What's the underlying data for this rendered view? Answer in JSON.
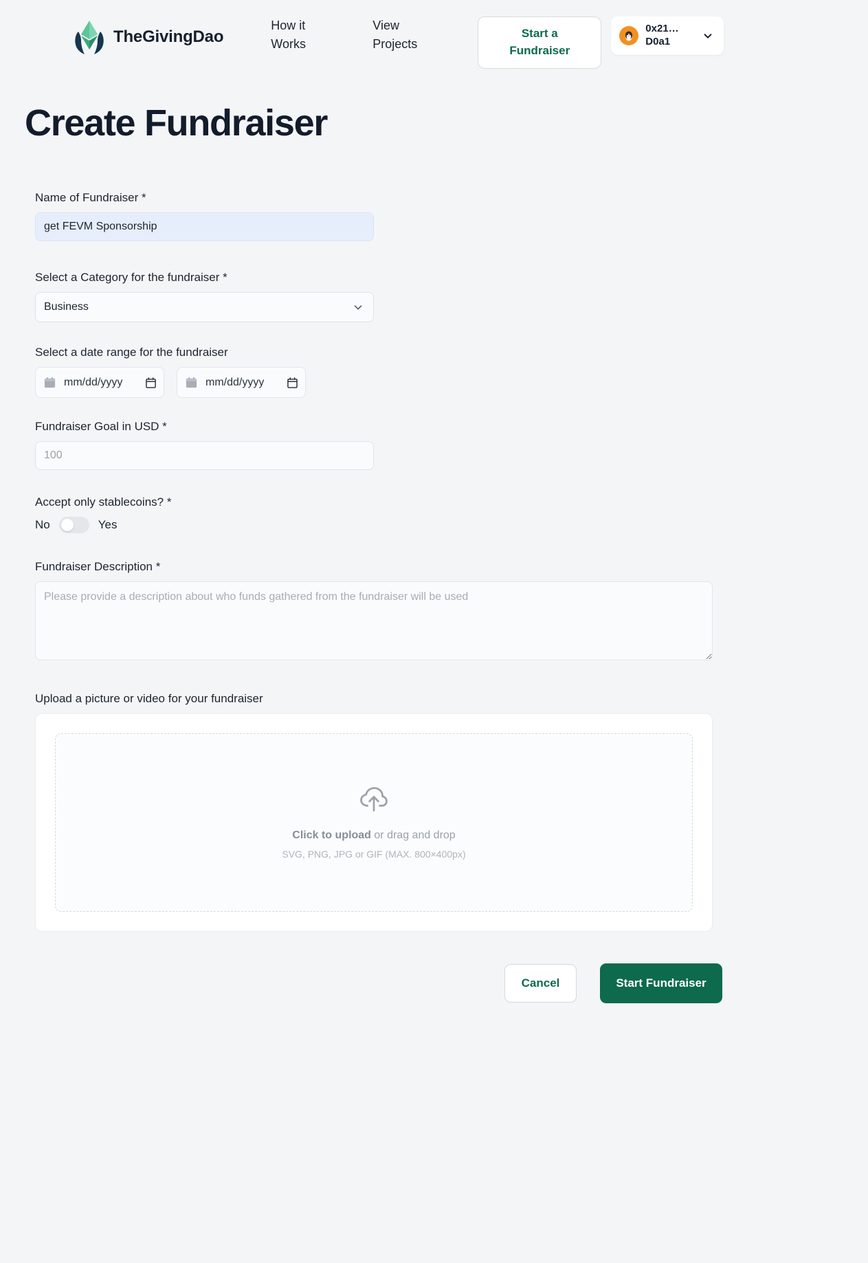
{
  "header": {
    "brand_name": "TheGivingDao",
    "logo_icon": "ethereum-hands-logo",
    "nav": [
      {
        "label": "How it Works",
        "name": "nav-how-it-works"
      },
      {
        "label": "View Projects",
        "name": "nav-view-projects"
      }
    ],
    "start_fundraiser_label": "Start a Fundraiser",
    "wallet": {
      "avatar_icon": "penguin-avatar-icon",
      "address_line1": "0x21…",
      "address_line2": "D0a1",
      "chevron_icon": "chevron-down-icon"
    }
  },
  "page": {
    "title": "Create Fundraiser"
  },
  "form": {
    "name": {
      "label": "Name of Fundraiser *",
      "value": "get FEVM Sponsorship",
      "placeholder": "Name of Fundraiser"
    },
    "category": {
      "label": "Select a Category for the fundraiser *",
      "value": "Business",
      "options": [
        "Business"
      ],
      "chevron_icon": "chevron-down-icon"
    },
    "date_range": {
      "label": "Select a date range for the fundraiser",
      "start_placeholder": "mm/dd/yyyy",
      "end_placeholder": "mm/dd/yyyy",
      "calendar_icon": "calendar-icon",
      "picker_icon": "calendar-picker-icon"
    },
    "goal": {
      "label": "Fundraiser Goal in USD *",
      "value": "",
      "placeholder": "100"
    },
    "stablecoins": {
      "label": "Accept only stablecoins? *",
      "off_label": "No",
      "on_label": "Yes",
      "state": "off"
    },
    "description": {
      "label": "Fundraiser Description *",
      "value": "",
      "placeholder": "Please provide a description about who funds gathered from the fundraiser will be used"
    },
    "upload": {
      "label": "Upload a picture or video for your fundraiser",
      "icon": "cloud-upload-icon",
      "primary_text_bold": "Click to upload",
      "primary_text_rest": " or drag and drop",
      "hint": "SVG, PNG, JPG or GIF (MAX. 800×400px)"
    }
  },
  "actions": {
    "cancel_label": "Cancel",
    "submit_label": "Start Fundraiser"
  },
  "colors": {
    "page_bg": "#f4f5f7",
    "brand_green": "#0d6a4c",
    "title_navy": "#131c2b",
    "filled_input_bg": "#e7eefb",
    "wallet_avatar_orange": "#f29023"
  }
}
